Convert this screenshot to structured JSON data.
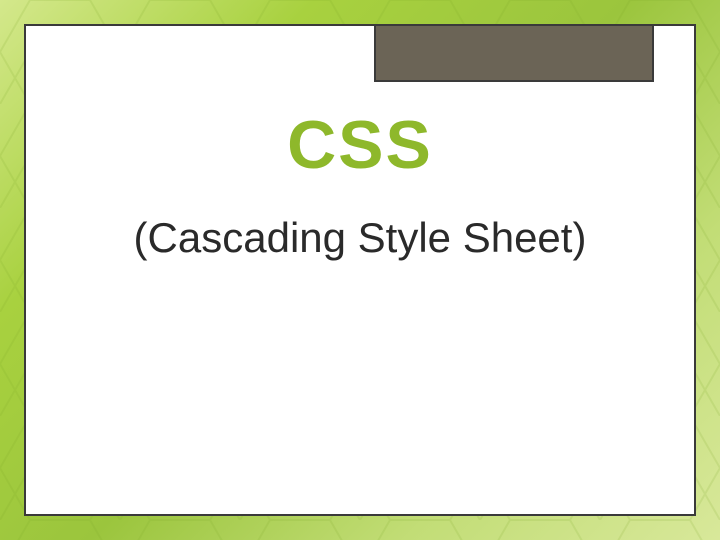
{
  "slide": {
    "title": "CSS",
    "subtitle": "(Cascading Style Sheet)"
  },
  "colors": {
    "accent": "#8eb82b",
    "box": "#6b6456",
    "border": "#3a3a3a",
    "text": "#2a2a2a"
  }
}
